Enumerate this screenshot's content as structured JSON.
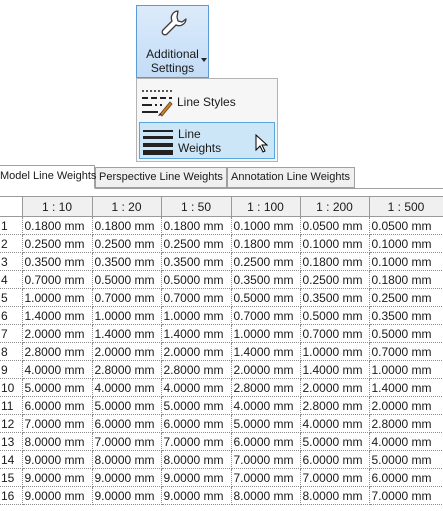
{
  "ribbon": {
    "additional_settings": {
      "line1": "Additional",
      "line2": "Settings",
      "icon": "wrench-icon"
    }
  },
  "menu": {
    "items": [
      {
        "label": "Line Styles",
        "icon": "line-styles-icon"
      },
      {
        "label": "Line Weights",
        "icon": "line-weights-icon",
        "state": "hovered"
      }
    ]
  },
  "tabs": [
    {
      "label": "Model Line Weights",
      "active": true
    },
    {
      "label": "Perspective Line Weights",
      "active": false
    },
    {
      "label": "Annotation Line Weights",
      "active": false
    }
  ],
  "grid": {
    "columns": [
      "1 : 10",
      "1 : 20",
      "1 : 50",
      "1 : 100",
      "1 : 200",
      "1 : 500"
    ],
    "rows": [
      {
        "n": "1",
        "cells": [
          "0.1800 mm",
          "0.1800 mm",
          "0.1800 mm",
          "0.1000 mm",
          "0.0500 mm",
          "0.0500 mm"
        ]
      },
      {
        "n": "2",
        "cells": [
          "0.2500 mm",
          "0.2500 mm",
          "0.2500 mm",
          "0.1800 mm",
          "0.1000 mm",
          "0.1000 mm"
        ]
      },
      {
        "n": "3",
        "cells": [
          "0.3500 mm",
          "0.3500 mm",
          "0.3500 mm",
          "0.2500 mm",
          "0.1800 mm",
          "0.1000 mm"
        ]
      },
      {
        "n": "4",
        "cells": [
          "0.7000 mm",
          "0.5000 mm",
          "0.5000 mm",
          "0.3500 mm",
          "0.2500 mm",
          "0.1800 mm"
        ]
      },
      {
        "n": "5",
        "cells": [
          "1.0000 mm",
          "0.7000 mm",
          "0.7000 mm",
          "0.5000 mm",
          "0.3500 mm",
          "0.2500 mm"
        ]
      },
      {
        "n": "6",
        "cells": [
          "1.4000 mm",
          "1.0000 mm",
          "1.0000 mm",
          "0.7000 mm",
          "0.5000 mm",
          "0.3500 mm"
        ]
      },
      {
        "n": "7",
        "cells": [
          "2.0000 mm",
          "1.4000 mm",
          "1.4000 mm",
          "1.0000 mm",
          "0.7000 mm",
          "0.5000 mm"
        ]
      },
      {
        "n": "8",
        "cells": [
          "2.8000 mm",
          "2.0000 mm",
          "2.0000 mm",
          "1.4000 mm",
          "1.0000 mm",
          "0.7000 mm"
        ]
      },
      {
        "n": "9",
        "cells": [
          "4.0000 mm",
          "2.8000 mm",
          "2.8000 mm",
          "2.0000 mm",
          "1.4000 mm",
          "1.0000 mm"
        ]
      },
      {
        "n": "10",
        "cells": [
          "5.0000 mm",
          "4.0000 mm",
          "4.0000 mm",
          "2.8000 mm",
          "2.0000 mm",
          "1.4000 mm"
        ]
      },
      {
        "n": "11",
        "cells": [
          "6.0000 mm",
          "5.0000 mm",
          "5.0000 mm",
          "4.0000 mm",
          "2.8000 mm",
          "2.0000 mm"
        ]
      },
      {
        "n": "12",
        "cells": [
          "7.0000 mm",
          "6.0000 mm",
          "6.0000 mm",
          "5.0000 mm",
          "4.0000 mm",
          "2.8000 mm"
        ]
      },
      {
        "n": "13",
        "cells": [
          "8.0000 mm",
          "7.0000 mm",
          "7.0000 mm",
          "6.0000 mm",
          "5.0000 mm",
          "4.0000 mm"
        ]
      },
      {
        "n": "14",
        "cells": [
          "9.0000 mm",
          "8.0000 mm",
          "8.0000 mm",
          "7.0000 mm",
          "6.0000 mm",
          "5.0000 mm"
        ]
      },
      {
        "n": "15",
        "cells": [
          "9.0000 mm",
          "9.0000 mm",
          "9.0000 mm",
          "7.0000 mm",
          "7.0000 mm",
          "6.0000 mm"
        ]
      },
      {
        "n": "16",
        "cells": [
          "9.0000 mm",
          "9.0000 mm",
          "9.0000 mm",
          "8.0000 mm",
          "8.0000 mm",
          "7.0000 mm"
        ]
      }
    ]
  }
}
